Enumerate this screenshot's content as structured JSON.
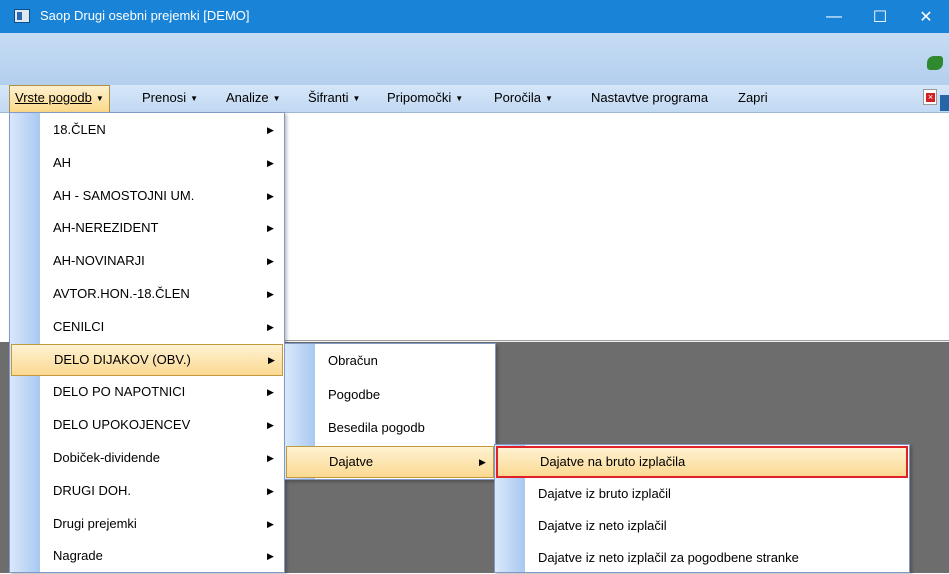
{
  "window": {
    "title": "Saop Drugi osebni prejemki [DEMO]",
    "minimize": "—",
    "maximize": "☐",
    "close": "✕"
  },
  "menubar": [
    {
      "label": "Vrste pogodb"
    },
    {
      "label": "Prenosi"
    },
    {
      "label": "Analize"
    },
    {
      "label": "Šifranti"
    },
    {
      "label": "Pripomočki"
    },
    {
      "label": "Poročila"
    },
    {
      "label": "Nastavtve programa"
    },
    {
      "label": "Zapri"
    }
  ],
  "menu1": [
    "18.ČLEN",
    "AH",
    "AH - SAMOSTOJNI UM.",
    "AH-NEREZIDENT",
    "AH-NOVINARJI",
    "AVTOR.HON.-18.ČLEN",
    "CENILCI",
    "DELO DIJAKOV (OBV.)",
    "DELO PO NAPOTNICI",
    "DELO UPOKOJENCEV",
    "Dobiček-dividende",
    "DRUGI DOH.",
    "Drugi prejemki",
    "Nagrade"
  ],
  "menu2": [
    "Obračun",
    "Pogodbe",
    "Besedila pogodb",
    "Dajatve"
  ],
  "menu3": [
    "Dajatve na bruto izplačila",
    "Dajatve iz bruto izplačil",
    "Dajatve iz neto izplačil",
    "Dajatve iz neto izplačil za pogodbene stranke"
  ],
  "glyphs": {
    "submenu_arrow": "▶",
    "dropdown_arrow": "▼"
  }
}
